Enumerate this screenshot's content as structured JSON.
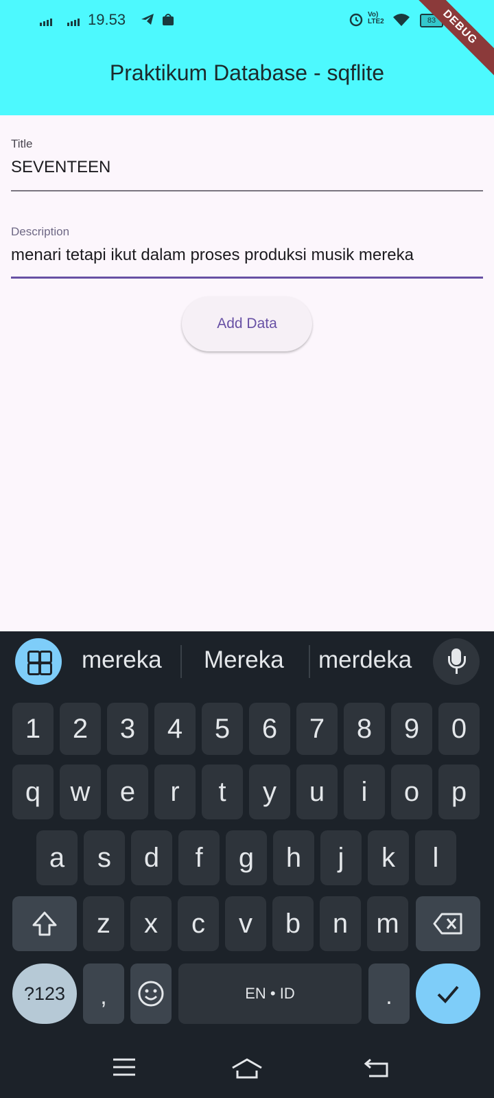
{
  "status_bar": {
    "time": "19.53",
    "battery": "83",
    "network": "LTE2"
  },
  "app_bar": {
    "title": "Praktikum Database - sqflite",
    "debug_banner": "DEBUG"
  },
  "form": {
    "title_label": "Title",
    "title_value": "SEVENTEEN",
    "description_label": "Description",
    "description_value": "menari tetapi ikut dalam proses produksi musik mereka",
    "add_button": "Add Data"
  },
  "keyboard": {
    "suggestions": [
      "mereka",
      "Mereka",
      "merdeka"
    ],
    "number_row": [
      "1",
      "2",
      "3",
      "4",
      "5",
      "6",
      "7",
      "8",
      "9",
      "0"
    ],
    "row1": [
      "q",
      "w",
      "e",
      "r",
      "t",
      "y",
      "u",
      "i",
      "o",
      "p"
    ],
    "row2": [
      "a",
      "s",
      "d",
      "f",
      "g",
      "h",
      "j",
      "k",
      "l"
    ],
    "row3": [
      "z",
      "x",
      "c",
      "v",
      "b",
      "n",
      "m"
    ],
    "symbols_key": "?123",
    "comma_key": ",",
    "space_label": "EN • ID",
    "period_key": "."
  },
  "colors": {
    "app_bar": "#4df9fe",
    "background": "#fcf6fc",
    "keyboard": "#1c2229",
    "accent": "#7ecdf9",
    "button_text": "#6750a4",
    "focused_underline": "#6750a4"
  }
}
